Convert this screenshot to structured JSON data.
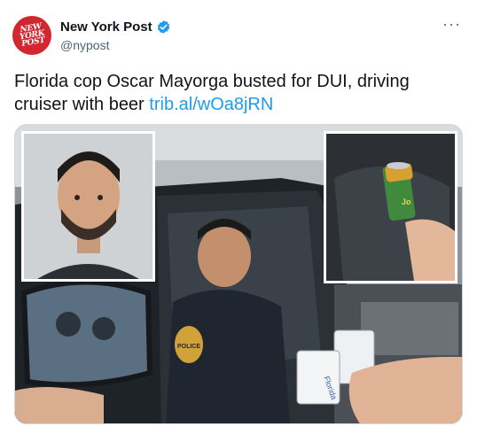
{
  "account": {
    "name": "New York Post",
    "handle": "@nypost",
    "logo_lines": [
      "NEW",
      "YORK",
      "POST"
    ],
    "verified_icon": "verified-badge-icon",
    "more_label": "···"
  },
  "tweet": {
    "text": "Florida cop Oscar Mayorga busted for DUI, driving cruiser with beer ",
    "link": "trib.al/wOa8jRN"
  },
  "media": {
    "badge_text": "POLICE",
    "card_text": "Florida",
    "can_text": "Jo"
  },
  "colors": {
    "brand_red": "#d22630",
    "link_blue": "#1d9bf0",
    "secondary_text": "#536471"
  }
}
